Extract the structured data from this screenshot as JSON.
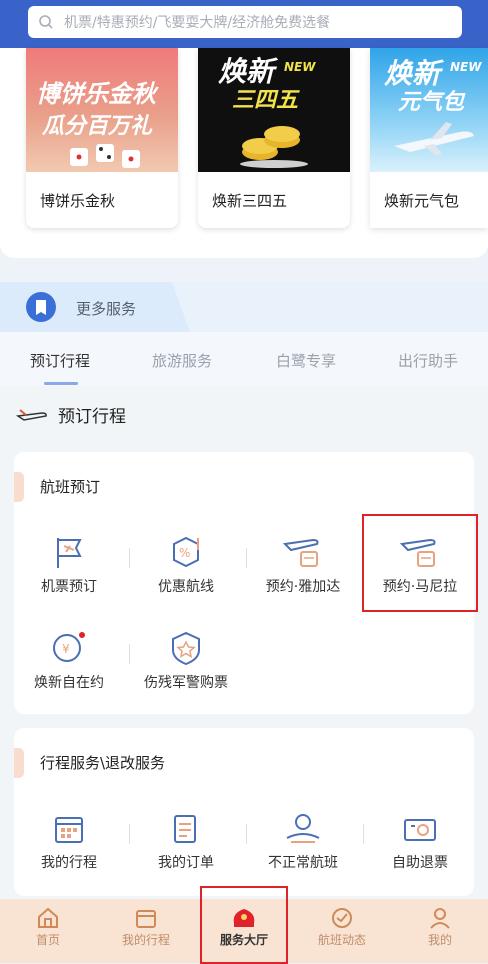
{
  "search": {
    "placeholder": "机票/特惠预约/飞要耍大牌/经济舱免费选餐"
  },
  "promos": [
    {
      "title": "博饼乐金秋",
      "banner": "博饼乐金秋",
      "banner_sub": "瓜分百万礼"
    },
    {
      "title": "焕新三四五",
      "banner": "焕新",
      "banner_new": "NEW",
      "banner_sub": "三四五"
    },
    {
      "title": "焕新元气包",
      "banner": "焕新",
      "banner_new": "NEW",
      "banner_sub": "元气包"
    }
  ],
  "more_services": {
    "label": "更多服务"
  },
  "tabs": [
    "预订行程",
    "旅游服务",
    "白鹭专享",
    "出行助手"
  ],
  "section": {
    "title": "预订行程"
  },
  "flight_booking": {
    "title": "航班预订",
    "items": [
      {
        "label": "机票预订",
        "icon": "flag-ticket-icon"
      },
      {
        "label": "优惠航线",
        "icon": "discount-route-icon"
      },
      {
        "label": "预约·雅加达",
        "icon": "plane-booking-icon"
      },
      {
        "label": "预约·马尼拉",
        "icon": "plane-booking-icon"
      },
      {
        "label": "焕新自在约",
        "icon": "clock-yuan-icon"
      },
      {
        "label": "伤残军警购票",
        "icon": "shield-star-icon"
      }
    ]
  },
  "trip_services": {
    "title": "行程服务\\退改服务",
    "items": [
      {
        "label": "我的行程",
        "icon": "calendar-icon"
      },
      {
        "label": "我的订单",
        "icon": "order-icon"
      },
      {
        "label": "不正常航班",
        "icon": "irregular-flight-icon"
      },
      {
        "label": "自助退票",
        "icon": "refund-ticket-icon"
      }
    ]
  },
  "bottom_nav": [
    {
      "label": "首页",
      "icon": "home-icon"
    },
    {
      "label": "我的行程",
      "icon": "calendar-icon"
    },
    {
      "label": "服务大厅",
      "icon": "service-hall-icon",
      "active": true
    },
    {
      "label": "航班动态",
      "icon": "flight-status-icon"
    },
    {
      "label": "我的",
      "icon": "profile-icon"
    }
  ],
  "colors": {
    "brand_blue": "#3a63c9",
    "highlight_red": "#e0232a",
    "nav_bg": "#f9e4d4"
  }
}
